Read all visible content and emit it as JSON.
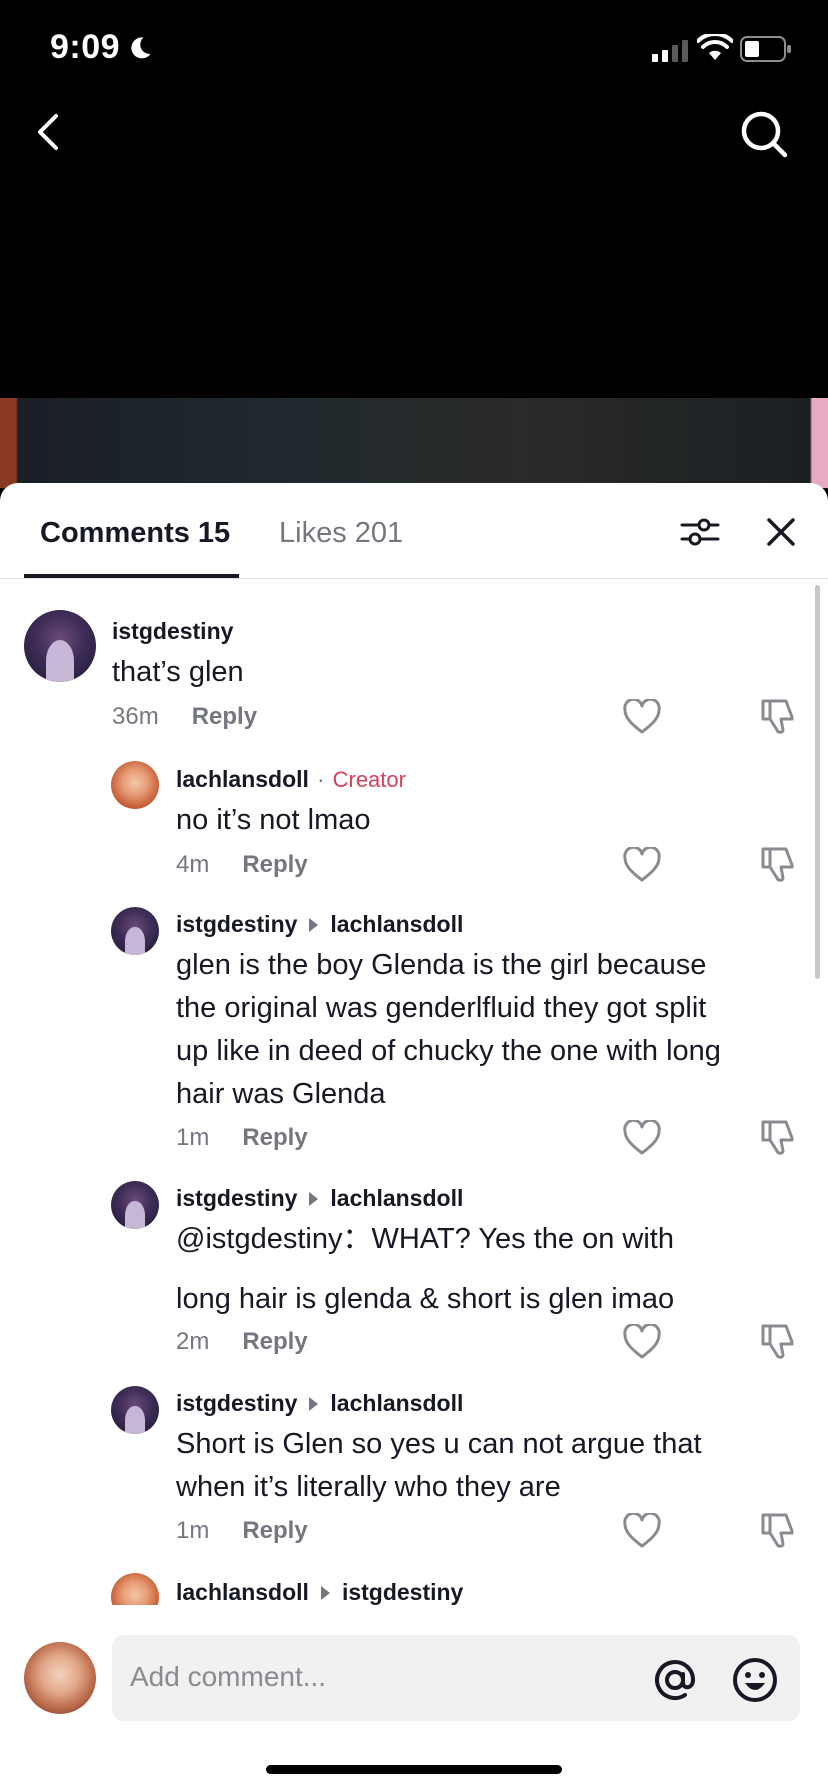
{
  "status_bar": {
    "time": "9:09"
  },
  "tabs": {
    "comments": "Comments 15",
    "likes": "Likes 201"
  },
  "comments": [
    {
      "username": "istgdestiny",
      "text": "that’s glen",
      "time": "36m",
      "reply": "Reply"
    },
    {
      "username": "lachlansdoll",
      "separator": "·",
      "badge": "Creator",
      "text": "no it’s not lmao",
      "time": "4m",
      "reply": "Reply"
    },
    {
      "username": "istgdestiny",
      "reply_to": "lachlansdoll",
      "text": "glen is the boy Glenda is the girl because the original was genderlfluid they got split up like in deed of chucky the one with long hair was Glenda",
      "time": "1m",
      "reply": "Reply"
    },
    {
      "username": "istgdestiny",
      "reply_to": "lachlansdoll",
      "text_line1": "@istgdestiny：WHAT? Yes the on with",
      "text_line2": "long hair is glenda & short is glen imao",
      "time": "2m",
      "reply": "Reply"
    },
    {
      "username": "istgdestiny",
      "reply_to": "lachlansdoll",
      "text": "Short is Glen so yes u can not argue that when it’s literally who they are",
      "time": "1m",
      "reply": "Reply"
    },
    {
      "username": "lachlansdoll",
      "reply_to": "istgdestiny"
    }
  ],
  "composer": {
    "placeholder": "Add comment..."
  },
  "colors": {
    "creator_badge": "#d7405e",
    "primary_text": "#161823",
    "secondary_text": "#757780"
  },
  "icons": [
    "back-icon",
    "search-icon",
    "filter-icon",
    "close-icon",
    "heart-icon",
    "dislike-icon",
    "at-icon",
    "emoji-icon"
  ]
}
